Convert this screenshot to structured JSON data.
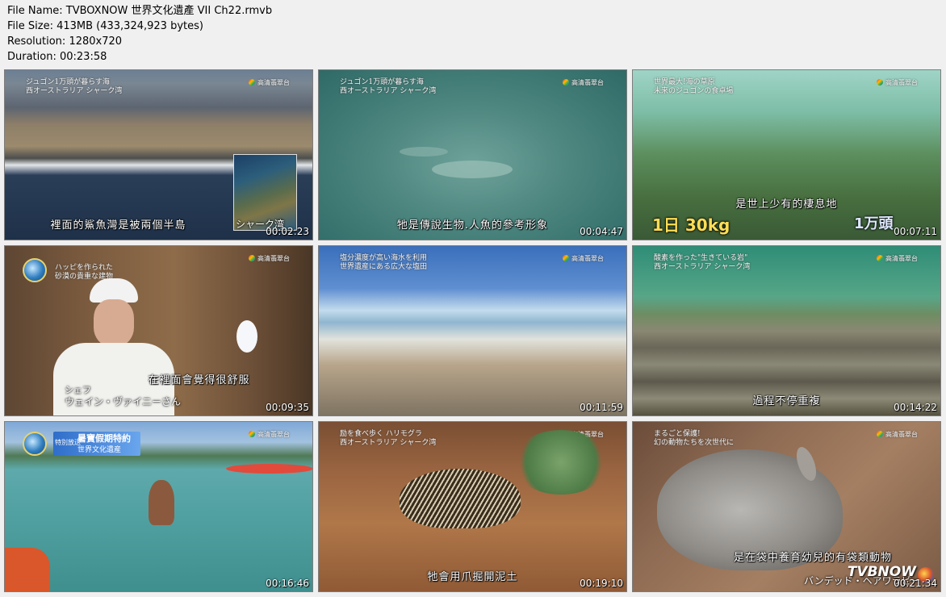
{
  "file_info": {
    "file_name": "File Name: TVBOXNOW 世界文化遺產 VII Ch22.rmvb",
    "file_size": "File Size: 413MB (433,324,923 bytes)",
    "resolution": "Resolution: 1280x720",
    "duration": "Duration: 00:23:58"
  },
  "station_logo": "高清翡翠台",
  "thumbnails": [
    {
      "caption": "ジュゴン1万頭が暮らす海\n西オーストラリア シャーク湾",
      "subtitle": "裡面的鯊魚灣是被兩個半島",
      "timestamp": "00:02:23",
      "map_label": "シャーク湾"
    },
    {
      "caption": "ジュゴン1万頭が暮らす海\n西オーストラリア シャーク湾",
      "subtitle": "牠是傳說生物.人魚的參考形象",
      "timestamp": "00:04:47"
    },
    {
      "caption": "世界最大!海の草原\n未来のジュゴンの食卓場",
      "subtitle": "是世上少有的棲息地",
      "timestamp": "00:07:11",
      "left_number": "1日 30kg",
      "right_number": "1万頭"
    },
    {
      "caption": "ハッピを作られた\n砂漠の貴重な建物",
      "subtitle": "在裡面會覺得很舒服",
      "timestamp": "00:09:35",
      "name_role": "シェフ",
      "name_person": "ウェイン・ヴァイニーさん"
    },
    {
      "caption": "塩分濃度が高い海水を利用\n世界遺産にある広大な塩田",
      "subtitle": "",
      "timestamp": "00:11:59"
    },
    {
      "caption": "酸素を作った\"生きている岩\"\n西オーストラリア シャーク湾",
      "subtitle": "過程不停重複",
      "timestamp": "00:14:22"
    },
    {
      "caption": "",
      "subtitle": "",
      "timestamp": "00:16:46",
      "banner_small": "特別放送",
      "banner_big": "暑寶假期特約",
      "banner_sub": "世界文化遺産"
    },
    {
      "caption": "励を食べ歩く ハリモグラ\n西オーストラリア シャーク湾",
      "subtitle": "牠會用爪掘開泥土",
      "timestamp": "00:19:10"
    },
    {
      "caption": "まるごと保護!\n幻の動物たちを次世代に",
      "subtitle": "是在袋中養育幼兒的有袋類動物",
      "timestamp": "00:21:34",
      "animal_name": "バンデッド・ヘアワラビー",
      "watermark": "TVBNOW"
    }
  ],
  "colors": {
    "background": "#f0f0f0",
    "thumb_border": "#7d7d7d"
  }
}
